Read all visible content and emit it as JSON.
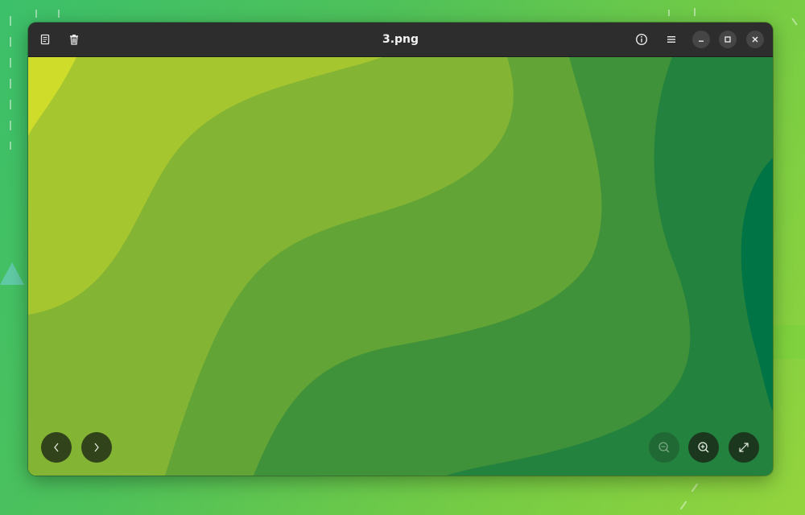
{
  "window": {
    "title": "3.png"
  },
  "header": {
    "left_buttons": [
      {
        "name": "properties",
        "icon": "document-properties-icon"
      },
      {
        "name": "delete",
        "icon": "trash-icon"
      }
    ],
    "right_buttons": [
      {
        "name": "info",
        "icon": "info-icon"
      },
      {
        "name": "main-menu",
        "icon": "hamburger-menu-icon"
      }
    ],
    "window_controls": [
      "minimize",
      "maximize",
      "close"
    ]
  },
  "image": {
    "colors": [
      "#cfdc2a",
      "#a6c630",
      "#84b434",
      "#62a436",
      "#3f913a",
      "#23823e",
      "#007445"
    ]
  },
  "osd": {
    "prev": {
      "icon": "chevron-left-icon"
    },
    "next": {
      "icon": "chevron-right-icon"
    },
    "zoom_out": {
      "icon": "zoom-out-icon",
      "enabled": false
    },
    "zoom_in": {
      "icon": "zoom-in-icon",
      "enabled": true
    },
    "fullscreen": {
      "icon": "fullscreen-icon"
    }
  }
}
